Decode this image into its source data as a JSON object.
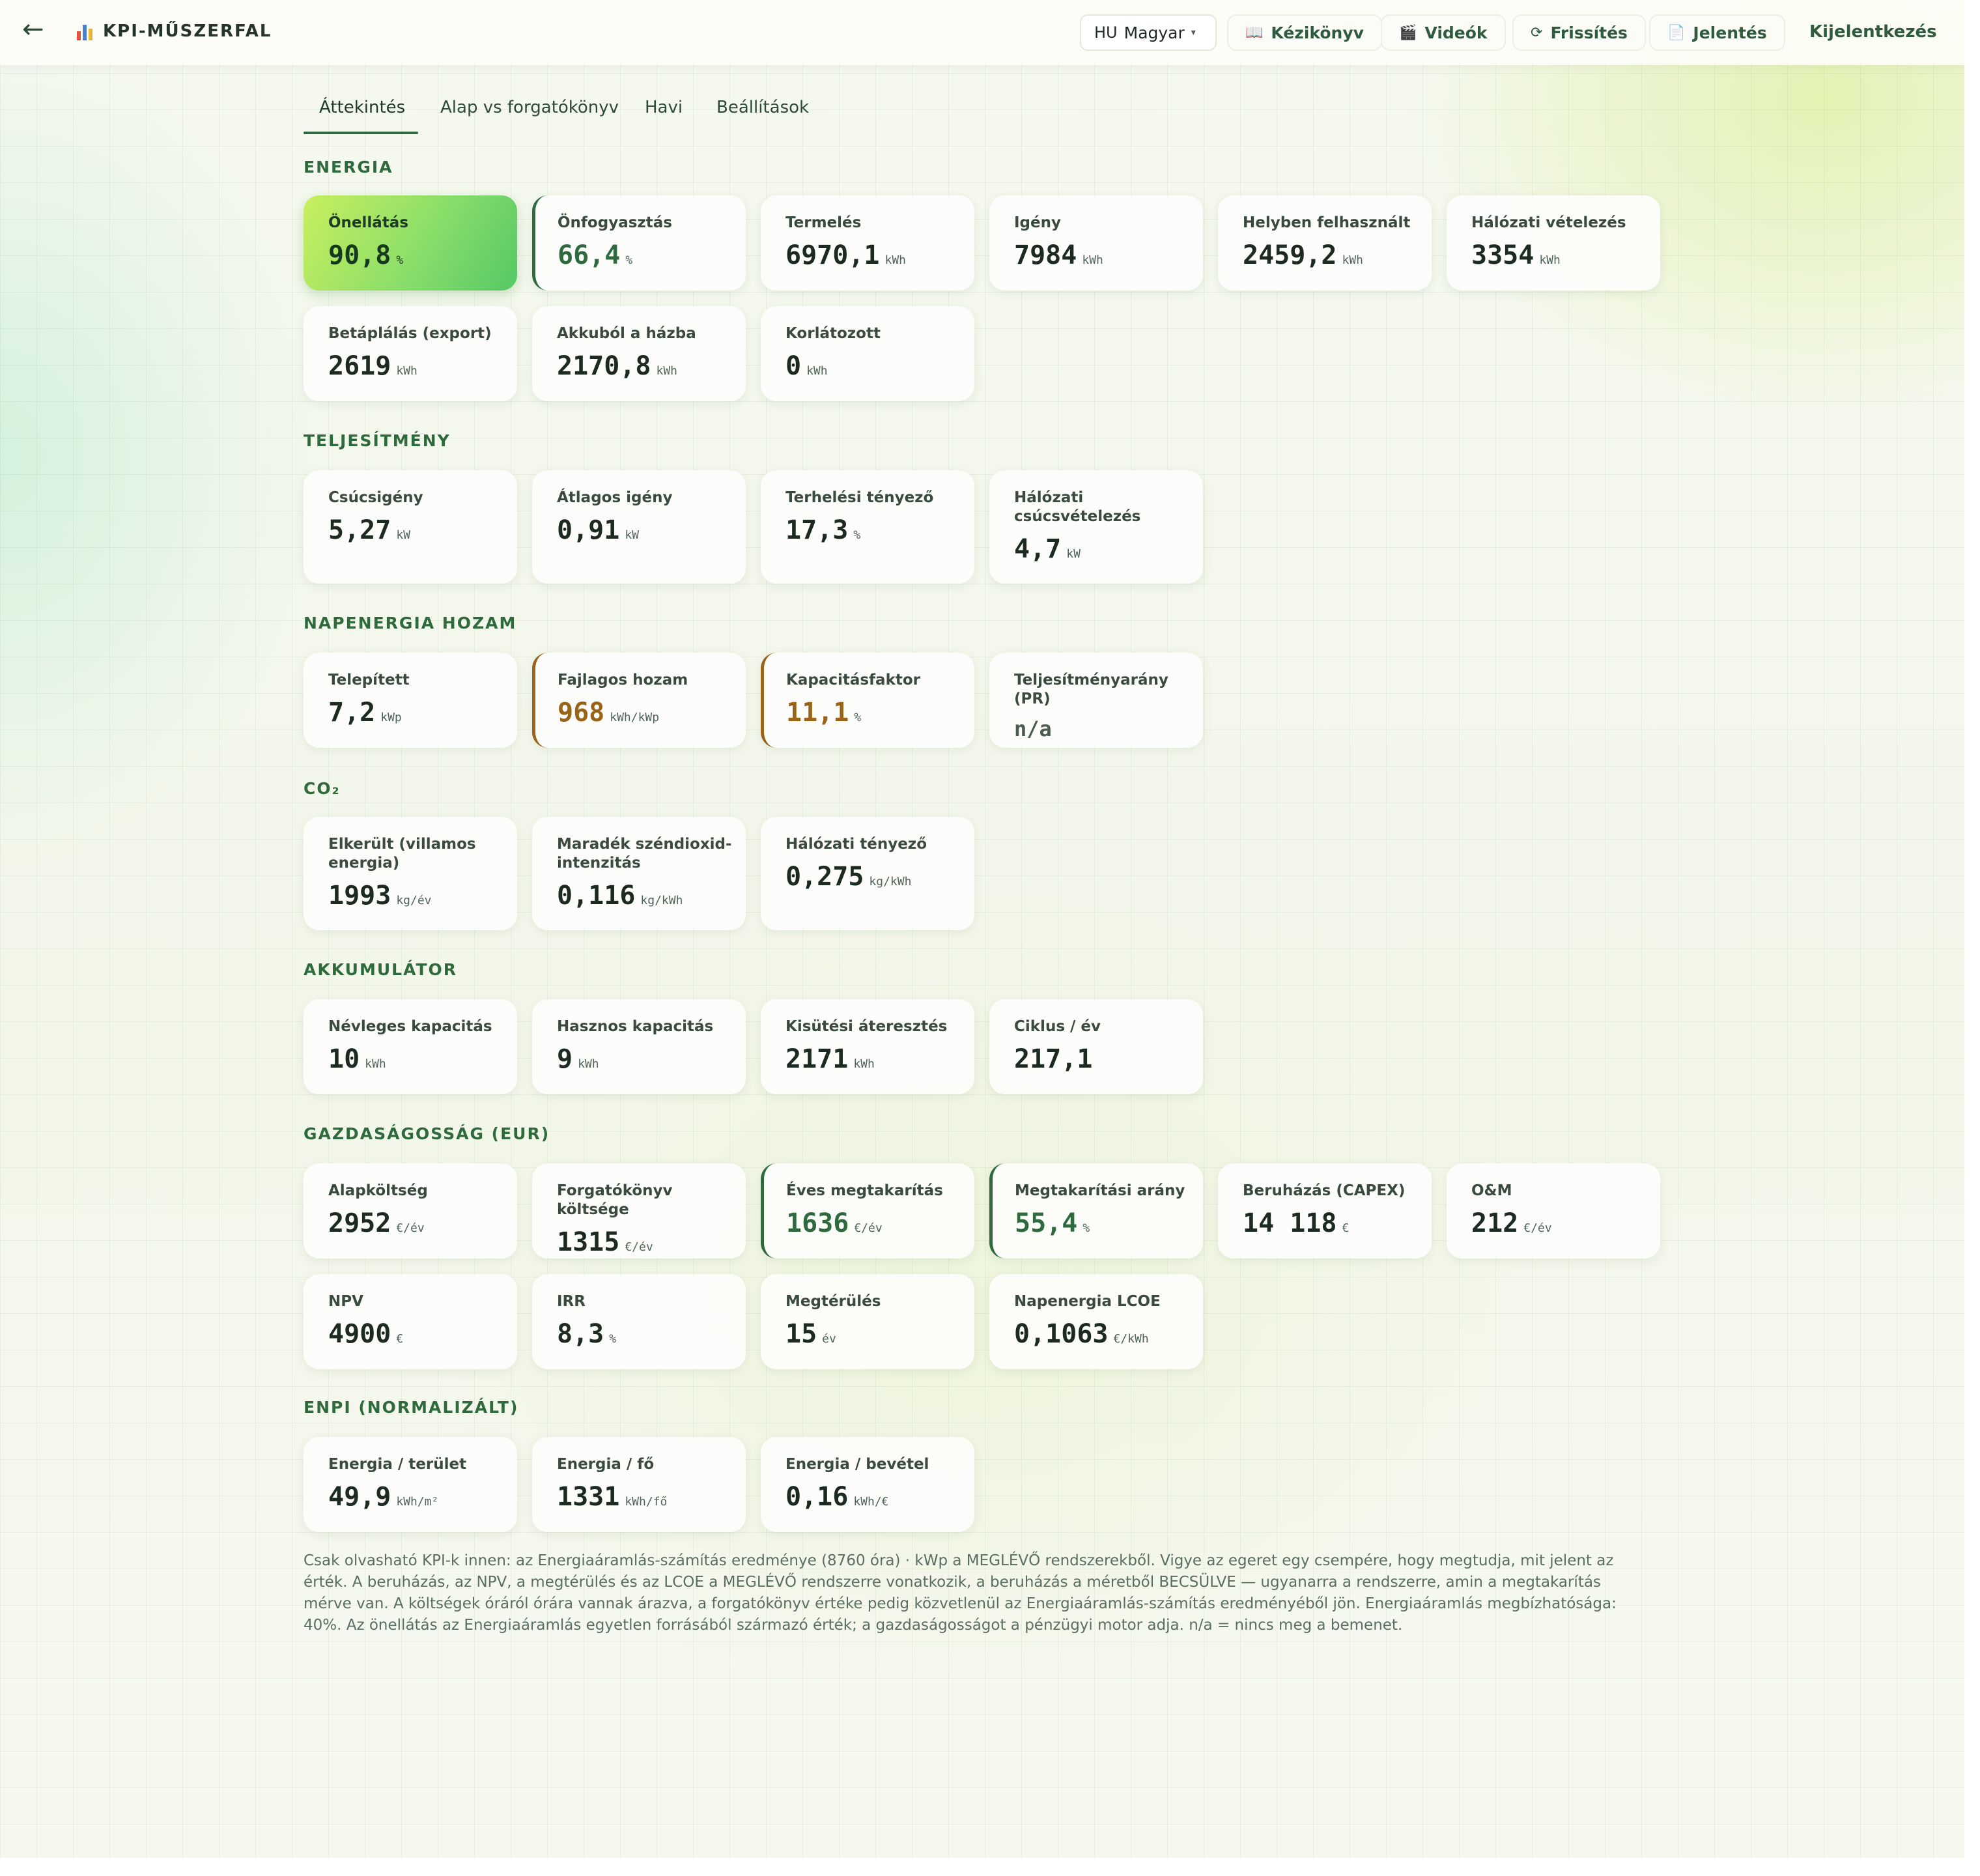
{
  "topbar": {
    "back_icon": "arrow-left-icon",
    "brand_icon": "bar-chart-icon",
    "title": "KPI-MŰSZERFAL",
    "language": {
      "code": "HU",
      "name": "Magyar",
      "caret": "▾"
    },
    "buttons": [
      {
        "key": "manual",
        "icon": "📖",
        "label": "Kézikönyv"
      },
      {
        "key": "videos",
        "icon": "🎬",
        "label": "Videók"
      },
      {
        "key": "refresh",
        "icon": "⟳",
        "label": "Frissítés"
      },
      {
        "key": "report",
        "icon": "📄",
        "label": "Jelentés"
      }
    ],
    "logout": "Kijelentkezés"
  },
  "tabs": [
    {
      "label": "Áttekintés",
      "active": true
    },
    {
      "label": "Alap vs forgatókönyv",
      "active": false
    },
    {
      "label": "Havi",
      "active": false
    },
    {
      "label": "Beállítások",
      "active": false
    }
  ],
  "colors": {
    "accent": "#2f6a3f",
    "amber": "#9a6418",
    "highlight": "#8ade6a"
  },
  "sections": {
    "energia": {
      "title": "ENERGIA",
      "cards": [
        {
          "label": "Önellátás",
          "value": "90,8",
          "unit": "%",
          "style": "highlight"
        },
        {
          "label": "Önfogyasztás",
          "value": "66,4",
          "unit": "%",
          "style": "green"
        },
        {
          "label": "Termelés",
          "value": "6970,1",
          "unit": "kWh"
        },
        {
          "label": "Igény",
          "value": "7984",
          "unit": "kWh"
        },
        {
          "label": "Helyben felhasznált",
          "value": "2459,2",
          "unit": "kWh"
        },
        {
          "label": "Hálózati vételezés",
          "value": "3354",
          "unit": "kWh"
        },
        {
          "label": "Betáplálás (export)",
          "value": "2619",
          "unit": "kWh"
        },
        {
          "label": "Akkuból a házba",
          "value": "2170,8",
          "unit": "kWh"
        },
        {
          "label": "Korlátozott",
          "value": "0",
          "unit": "kWh"
        }
      ]
    },
    "teljesitmeny": {
      "title": "TELJESÍTMÉNY",
      "cards": [
        {
          "label": "Csúcsigény",
          "value": "5,27",
          "unit": "kW"
        },
        {
          "label": "Átlagos igény",
          "value": "0,91",
          "unit": "kW"
        },
        {
          "label": "Terhelési tényező",
          "value": "17,3",
          "unit": "%"
        },
        {
          "label": "Hálózati csúcsvételezés",
          "value": "4,7",
          "unit": "kW"
        }
      ]
    },
    "napenergia": {
      "title": "NAPENERGIA HOZAM",
      "cards": [
        {
          "label": "Telepített",
          "value": "7,2",
          "unit": "kWp"
        },
        {
          "label": "Fajlagos hozam",
          "value": "968",
          "unit": "kWh/kWp",
          "style": "amber"
        },
        {
          "label": "Kapacitásfaktor",
          "value": "11,1",
          "unit": "%",
          "style": "amber"
        },
        {
          "label": "Teljesítményarány (PR)",
          "value": "n/a",
          "unit": "",
          "style": "muted"
        }
      ]
    },
    "co2": {
      "title": "CO₂",
      "cards": [
        {
          "label": "Elkerült (villamos energia)",
          "value": "1993",
          "unit": "kg/év"
        },
        {
          "label": "Maradék széndioxid-intenzitás",
          "value": "0,116",
          "unit": "kg/kWh"
        },
        {
          "label": "Hálózati tényező",
          "value": "0,275",
          "unit": "kg/kWh"
        }
      ]
    },
    "akkumulator": {
      "title": "AKKUMULÁTOR",
      "cards": [
        {
          "label": "Névleges kapacitás",
          "value": "10",
          "unit": "kWh"
        },
        {
          "label": "Hasznos kapacitás",
          "value": "9",
          "unit": "kWh"
        },
        {
          "label": "Kisütési áteresztés",
          "value": "2171",
          "unit": "kWh"
        },
        {
          "label": "Ciklus / év",
          "value": "217,1",
          "unit": ""
        }
      ]
    },
    "gazdasagossag": {
      "title": "GAZDASÁGOSSÁG (EUR)",
      "cards": [
        {
          "label": "Alapköltség",
          "value": "2952",
          "unit": "€/év"
        },
        {
          "label": "Forgatókönyv költsége",
          "value": "1315",
          "unit": "€/év"
        },
        {
          "label": "Éves megtakarítás",
          "value": "1636",
          "unit": "€/év",
          "style": "green"
        },
        {
          "label": "Megtakarítási arány",
          "value": "55,4",
          "unit": "%",
          "style": "green"
        },
        {
          "label": "Beruházás (CAPEX)",
          "value": "14 118",
          "unit": "€"
        },
        {
          "label": "O&M",
          "value": "212",
          "unit": "€/év"
        },
        {
          "label": "NPV",
          "value": "4900",
          "unit": "€"
        },
        {
          "label": "IRR",
          "value": "8,3",
          "unit": "%"
        },
        {
          "label": "Megtérülés",
          "value": "15",
          "unit": "év"
        },
        {
          "label": "Napenergia LCOE",
          "value": "0,1063",
          "unit": "€/kWh"
        }
      ]
    },
    "enpi": {
      "title": "ENPI (NORMALIZÁLT)",
      "cards": [
        {
          "label": "Energia / terület",
          "value": "49,9",
          "unit": "kWh/m²"
        },
        {
          "label": "Energia / fő",
          "value": "1331",
          "unit": "kWh/fő"
        },
        {
          "label": "Energia / bevétel",
          "value": "0,16",
          "unit": "kWh/€"
        }
      ]
    }
  },
  "footnote": "Csak olvasható KPI-k innen: az Energiaáramlás-számítás eredménye (8760 óra) · kWp a MEGLÉVŐ rendszerekből. Vigye az egeret egy csempére, hogy megtudja, mit jelent az érték. A beruházás, az NPV, a megtérülés és az LCOE a MEGLÉVŐ rendszerre vonatkozik, a beruházás a méretből BECSÜLVE — ugyanarra a rendszerre, amin a megtakarítás mérve van. A költségek óráról órára vannak árazva, a forgatókönyv értéke pedig közvetlenül az Energiaáramlás-számítás eredményéből jön. Energiaáramlás megbízhatósága: 40%. Az önellátás az Energiaáramlás egyetlen forrásából származó érték; a gazdaságosságot a pénzügyi motor adja. n/a = nincs meg a bemenet."
}
